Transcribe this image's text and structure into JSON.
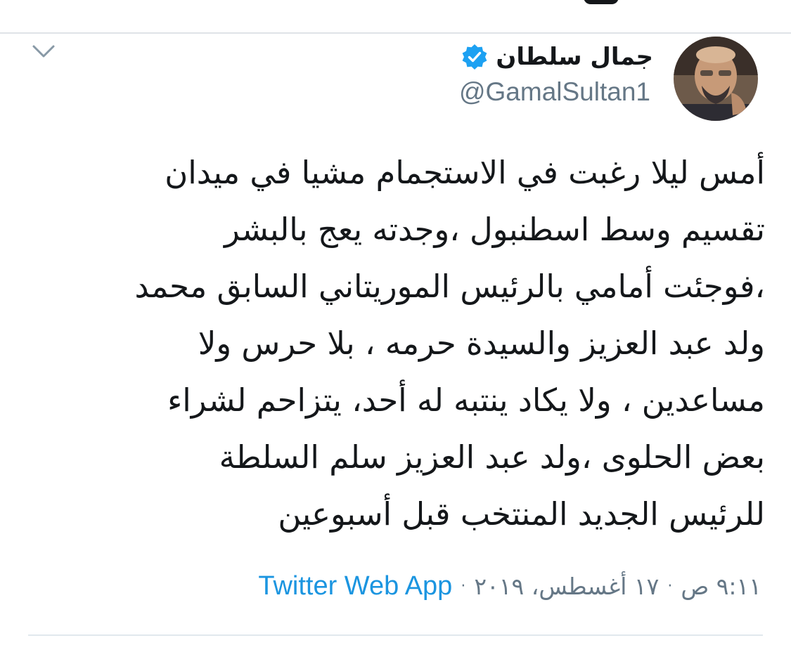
{
  "author": {
    "display_name": "جمال سلطان",
    "handle": "@GamalSultan1",
    "verified": true,
    "avatar_icon": "profile-photo"
  },
  "tweet": {
    "lines": [
      "أمس ليلا رغبت في الاستجمام مشيا في ميدان",
      "تقسيم وسط اسطنبول ،وجدته يعج بالبشر",
      "،فوجئت أمامي بالرئيس الموريتاني السابق محمد",
      "ولد عبد العزيز والسيدة حرمه ، بلا حرس ولا",
      "مساعدين ، ولا يكاد ينتبه له أحد، يتزاحم لشراء",
      "بعض الحلوى ،ولد عبد العزيز سلم السلطة",
      "للرئيس الجديد المنتخب قبل أسبوعين"
    ]
  },
  "meta": {
    "time": "٩:١١ ص",
    "separator": "·",
    "date": "١٧ أغسطس، ٢٠١٩",
    "source": "Twitter Web App"
  },
  "colors": {
    "text": "#14171a",
    "secondary": "#657786",
    "link": "#1b95e0",
    "verified": "#1da1f2",
    "divider": "#e1e8ed"
  },
  "icons": {
    "more_menu": "chevron-down-icon",
    "verified": "verified-badge-icon"
  }
}
